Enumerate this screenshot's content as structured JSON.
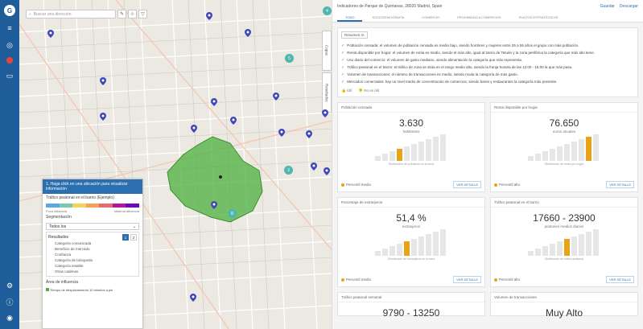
{
  "rail": {
    "icons": [
      "logo-icon",
      "layers-icon",
      "target-icon",
      "palette-icon",
      "list-icon"
    ],
    "bottom_icons": [
      "settings-icon",
      "info-icon",
      "user-icon"
    ]
  },
  "map": {
    "search_placeholder": "Buscar una dirección",
    "tabs": [
      "Capas",
      "Resultados"
    ],
    "legend": {
      "header": "1. Haga click en una ubicación para visualizar información",
      "var_label": "Tráfico peatonal en el barrio (Ejemplo)",
      "scale_low": "Poca afluencia",
      "scale_high": "Máxima afluencia",
      "seg_label": "Segmentación",
      "seg_value": "Todos los",
      "box_title": "Resultados",
      "page": [
        "1",
        "2"
      ],
      "cats": [
        "Categoría comunicada",
        "Beneficio de mercado",
        "Confianza",
        "Categoría de búsqueda",
        "Categoría estable",
        "Otras cadenas"
      ],
      "area_label": "Área de influencia",
      "area_note": "Tiempo de desplazamiento 10 minutos a pie"
    },
    "bubbles": [
      "4",
      "5",
      "3",
      "8"
    ]
  },
  "panel": {
    "title": "Indicadores de Parque de Quintanas, 28020 Madrid, Spain",
    "actions": [
      "Guardar",
      "Descargar"
    ],
    "tabs": [
      "Todo",
      "Sociodemografía",
      "Comercio",
      "Proximidad a comercios",
      "Puntos estratégicos"
    ],
    "summary_chip": "Resumen IA",
    "summary_lines": [
      "Población censada: el volumen de población censada es medio bajo, siendo hombres y mujeres entre 25 a 55 años el grupo con más población.",
      "Renta disponible por hogar: el volumen de renta es medio, siendo el más alto, igual al barrio de Tetuán y la zona periférica la categoría que más alto tiene.",
      "Uso diario del comercio: el volumen de gasto mediano, siendo alimentación la categoría que más representa.",
      "Tráfico peatonal en el barrio: el tráfico de zona se sitúa en el rango medio alto, siendo la franja horaria de las 12:00 - 15:00 la que más pasa.",
      "Volumen de transacciones: el número de transacciones es medio, siendo moda la categoría de más gasto.",
      "Mercados comerciales: hay un nivel medio de concentración de comercios, siendo bares y restaurantes la categoría más presente."
    ],
    "summary_footer": [
      "Útil",
      "No es útil"
    ],
    "cards": [
      {
        "title": "Población censada",
        "value": "3.630",
        "unit": "habitantes",
        "caption": "Distribución de población en la zona",
        "highlight": 4,
        "foot": "Percentil medio",
        "btn": "Ver detalle"
      },
      {
        "title": "Renta disponible por hogar",
        "value": "76.650",
        "unit": "euros anuales",
        "caption": "Distribución de renta por hogar",
        "highlight": 9,
        "foot": "Percentil alto",
        "btn": "Ver detalle"
      },
      {
        "title": "Porcentaje de extranjeros",
        "value": "51,4 %",
        "unit": "extranjeros",
        "caption": "Distribución de extranjeros en la zona",
        "highlight": 5,
        "foot": "Percentil medio",
        "btn": "Ver detalle"
      },
      {
        "title": "Tráfico peatonal en el barrio",
        "value": "17660 - 23900",
        "unit": "peatones medios diarios",
        "caption": "Distribución de tráfico peatonal",
        "highlight": 6,
        "foot": "Percentil alto",
        "btn": "Ver detalle"
      },
      {
        "title": "Tráfico peatonal semanal",
        "value": "9790 - 13250",
        "unit": "",
        "caption": "",
        "highlight": 0,
        "foot": "",
        "btn": ""
      },
      {
        "title": "Volumen de transacciones",
        "value": "Muy Alto",
        "unit": "",
        "caption": "",
        "highlight": 0,
        "foot": "",
        "btn": ""
      }
    ]
  },
  "colors": {
    "rail": "#1f5d9a",
    "accent": "#2c6fae",
    "highlight": "#e8a317",
    "area": "#4caf3e"
  }
}
